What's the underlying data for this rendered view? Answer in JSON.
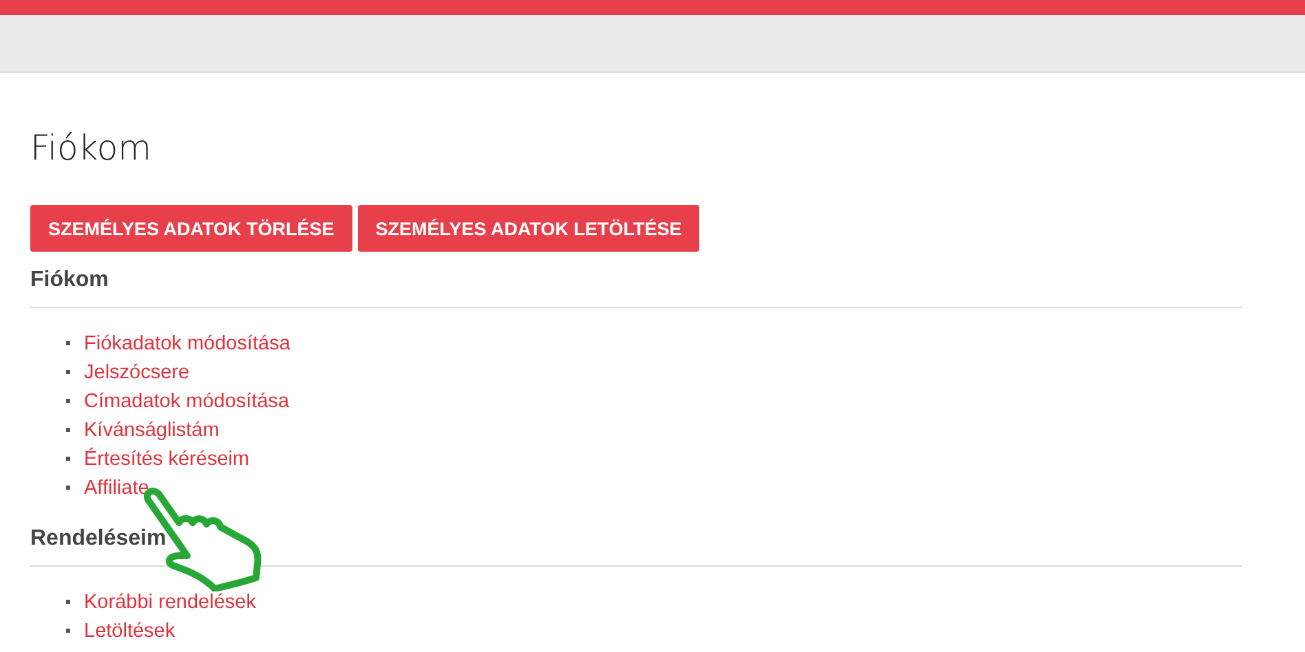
{
  "page_title": "Fiókom",
  "buttons": [
    "SZEMÉLYES ADATOK TÖRLÉSE",
    "SZEMÉLYES ADATOK LETÖLTÉSE"
  ],
  "sections": [
    {
      "heading": "Fiókom",
      "links": [
        "Fiókadatok módosítása",
        "Jelszócsere",
        "Címadatok módosítása",
        "Kívánságlistám",
        "Értesítés kéréseim",
        "Affiliate"
      ]
    },
    {
      "heading": "Rendeléseim",
      "links": [
        "Korábbi rendelések",
        "Letöltések"
      ]
    }
  ]
}
